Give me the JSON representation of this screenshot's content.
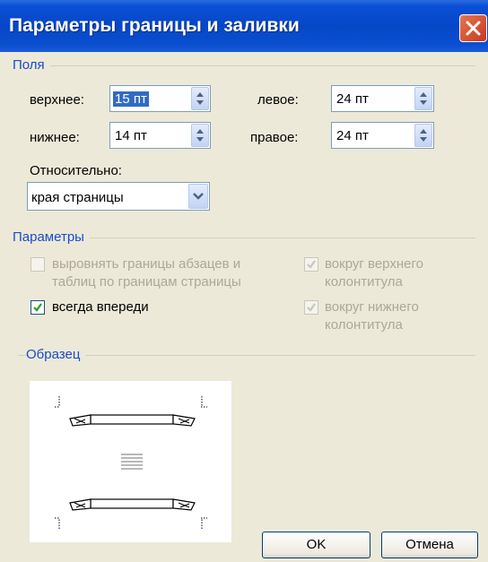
{
  "window": {
    "title": "Параметры границы и заливки"
  },
  "fields_group": {
    "label": "Поля",
    "top_label": "верхнее:",
    "top_value": "15 пт",
    "bottom_label": "нижнее:",
    "bottom_value": "14 пт",
    "left_label": "левое:",
    "left_value": "24 пт",
    "right_label": "правое:",
    "right_value": "24 пт",
    "relative_label": "Относительно:",
    "relative_value": "края страницы"
  },
  "options_group": {
    "label": "Параметры",
    "align_line1": "выровнять границы абзацев и",
    "align_line2": "таблиц по границам страницы",
    "align_checked": false,
    "always_front": "всегда впереди",
    "always_front_checked": true,
    "around_header_line1": "вокруг верхнего",
    "around_header_line2": "колонтитула",
    "around_header_checked": true,
    "around_footer_line1": "вокруг нижнего",
    "around_footer_line2": "колонтитула",
    "around_footer_checked": true
  },
  "sample_group": {
    "label": "Образец"
  },
  "buttons": {
    "ok": "OK",
    "cancel": "Отмена"
  },
  "colors": {
    "title_bar": "#0547c7",
    "group_label": "#1a4bd1",
    "dialog_bg": "#ece9d8",
    "close_button": "#c9371c"
  }
}
